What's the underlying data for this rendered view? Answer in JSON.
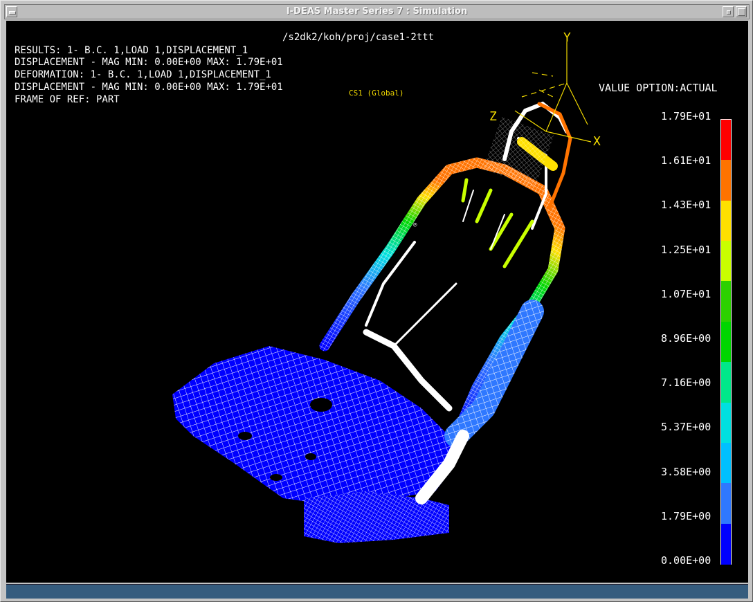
{
  "window": {
    "title": "I-DEAS Master Series 7 :   Simulation"
  },
  "viewport": {
    "model_path": "/s2dk2/koh/proj/case1-2ttt",
    "header_lines": [
      "RESULTS: 1- B.C. 1,LOAD 1,DISPLACEMENT_1",
      "DISPLACEMENT - MAG MIN: 0.00E+00 MAX: 1.79E+01",
      "DEFORMATION: 1- B.C. 1,LOAD 1,DISPLACEMENT_1",
      "DISPLACEMENT - MAG MIN: 0.00E+00 MAX: 1.79E+01",
      "FRAME OF REF: PART"
    ],
    "coord_system_label": "CS1 (Global)",
    "node_label": "℗",
    "value_option": "VALUE OPTION:ACTUAL",
    "axes": {
      "x": "X",
      "y": "Y",
      "z": "Z"
    }
  },
  "legend": {
    "labels": [
      "1.79E+01",
      "1.61E+01",
      "1.43E+01",
      "1.25E+01",
      "1.07E+01",
      "8.96E+00",
      "7.16E+00",
      "5.37E+00",
      "3.58E+00",
      "1.79E+00",
      "0.00E+00"
    ],
    "colors": [
      "#ff0000",
      "#ff7300",
      "#ffe000",
      "#c9ff00",
      "#2cd100",
      "#00d600",
      "#00e88a",
      "#00e0e0",
      "#00c0ff",
      "#2f78ff",
      "#0000ff"
    ]
  },
  "colors": {
    "background": "#000000",
    "mesh_line": "#ffffff",
    "status_bar": "#355c7e",
    "axis_triad": "#f0d800"
  }
}
